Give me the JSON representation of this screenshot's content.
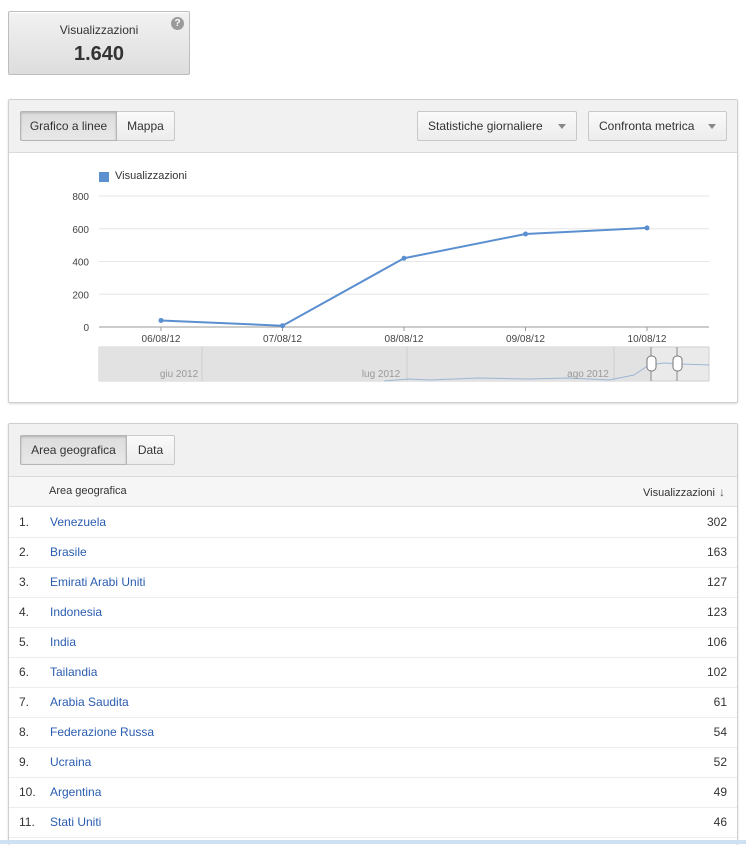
{
  "metric": {
    "label": "Visualizzazioni",
    "value": "1.640",
    "help_icon": "question-mark"
  },
  "chart_toolbar": {
    "tab_line": "Grafico a linee",
    "tab_map": "Mappa",
    "dropdown_stats": "Statistiche giornaliere",
    "dropdown_compare": "Confronta metrica"
  },
  "chart_data": {
    "type": "line",
    "legend": "Visualizzazioni",
    "series_color": "#5b8fd0",
    "x": [
      "06/08/12",
      "07/08/12",
      "08/08/12",
      "09/08/12",
      "10/08/12"
    ],
    "series": [
      {
        "name": "Visualizzazioni",
        "values": [
          40,
          8,
          420,
          568,
          605
        ]
      }
    ],
    "y_ticks": [
      "800",
      "600",
      "400",
      "200",
      "0"
    ],
    "ylim": [
      0,
      800
    ],
    "timeline_labels": [
      "giu 2012",
      "lug 2012",
      "ago 2012"
    ]
  },
  "table_toolbar": {
    "tab_region": "Area geografica",
    "tab_date": "Data"
  },
  "table": {
    "col_region": "Area geografica",
    "col_views": "Visualizzazioni",
    "rows": [
      {
        "rank": "1.",
        "name": "Venezuela",
        "value": "302"
      },
      {
        "rank": "2.",
        "name": "Brasile",
        "value": "163"
      },
      {
        "rank": "3.",
        "name": "Emirati Arabi Uniti",
        "value": "127"
      },
      {
        "rank": "4.",
        "name": "Indonesia",
        "value": "123"
      },
      {
        "rank": "5.",
        "name": "India",
        "value": "106"
      },
      {
        "rank": "6.",
        "name": "Tailandia",
        "value": "102"
      },
      {
        "rank": "7.",
        "name": "Arabia Saudita",
        "value": "61"
      },
      {
        "rank": "8.",
        "name": "Federazione Russa",
        "value": "54"
      },
      {
        "rank": "9.",
        "name": "Ucraina",
        "value": "52"
      },
      {
        "rank": "10.",
        "name": "Argentina",
        "value": "49"
      },
      {
        "rank": "11.",
        "name": "Stati Uniti",
        "value": "46"
      }
    ]
  }
}
